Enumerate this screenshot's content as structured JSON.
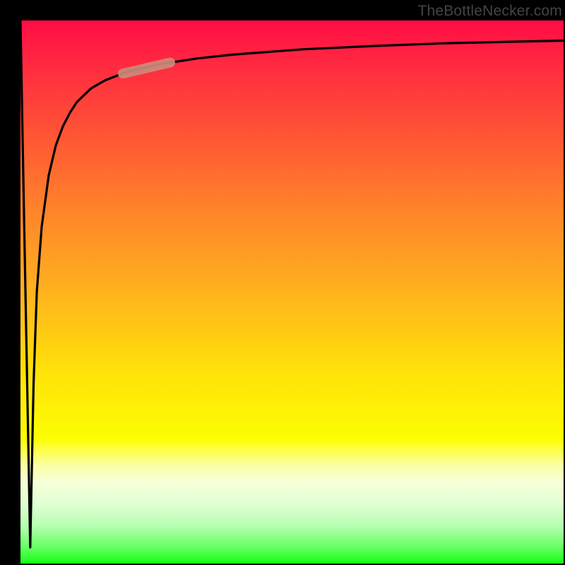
{
  "chart_data": {
    "type": "line",
    "title": "",
    "xlabel": "",
    "ylabel": "",
    "xlim": [
      0,
      100
    ],
    "ylim": [
      0,
      100
    ],
    "grid": false,
    "series": [
      {
        "name": "curve",
        "x": [
          0,
          0.6,
          1.2,
          1.8,
          2.4,
          3.0,
          3.9,
          5.2,
          6.5,
          7.8,
          9.1,
          10.4,
          13.0,
          15.6,
          19.5,
          26.0,
          32.5,
          39.0,
          52.0,
          65.0,
          78.0,
          91.0,
          100.0
        ],
        "values": [
          100.0,
          67.0,
          35.0,
          3.0,
          33.0,
          50.0,
          62.0,
          71.5,
          77.0,
          80.5,
          83.0,
          85.0,
          87.5,
          89.0,
          90.5,
          92.0,
          93.0,
          93.7,
          94.7,
          95.3,
          95.8,
          96.1,
          96.3
        ]
      }
    ],
    "highlight_segment": {
      "x_range": [
        18.8,
        27.5
      ],
      "approx_y": 85
    }
  },
  "watermark": {
    "text": "TheBottleNecker.com"
  },
  "colors": {
    "curve": "#000000",
    "highlight": "#cb8a7b",
    "frame": "#000000"
  }
}
